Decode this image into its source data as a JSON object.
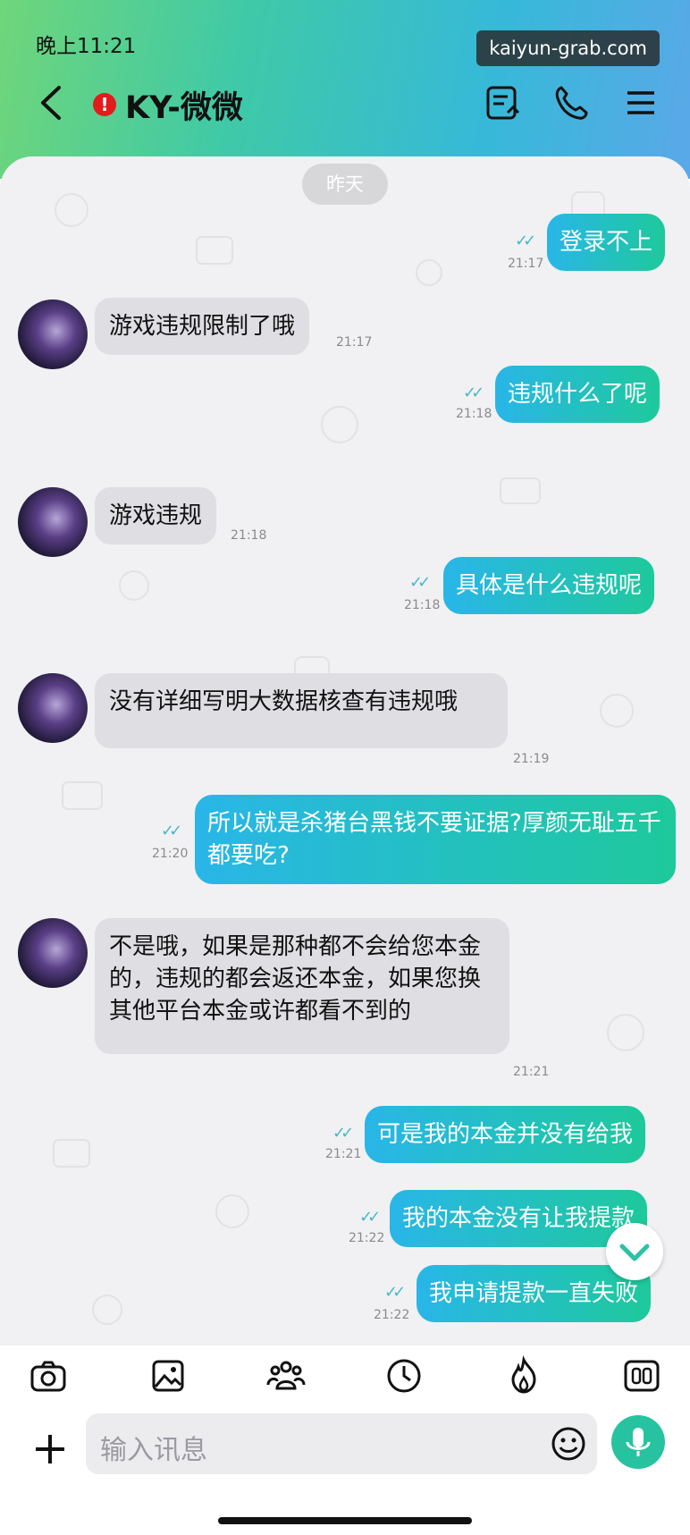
{
  "status": {
    "time": "晚上11:21",
    "watermark": "kaiyun-grab.com"
  },
  "header": {
    "title": "KY-微微",
    "alert": "!"
  },
  "chat": {
    "date_divider": "昨天",
    "messages": [
      {
        "dir": "out",
        "text": "登录不上",
        "time": "21:17"
      },
      {
        "dir": "in",
        "text": "游戏违规限制了哦",
        "time": "21:17"
      },
      {
        "dir": "out",
        "text": "违规什么了呢",
        "time": "21:18"
      },
      {
        "dir": "in",
        "text": "游戏违规",
        "time": "21:18"
      },
      {
        "dir": "out",
        "text": "具体是什么违规呢",
        "time": "21:18"
      },
      {
        "dir": "in",
        "text": "没有详细写明大数据核查有违规哦",
        "time": "21:19"
      },
      {
        "dir": "out",
        "text": "所以就是杀猪台黑钱不要证据?厚颜无耻五千都要吃?",
        "time": "21:20"
      },
      {
        "dir": "in",
        "text": "不是哦，如果是那种都不会给您本金的，违规的都会返还本金，如果您换其他平台本金或许都看不到的",
        "time": "21:21"
      },
      {
        "dir": "out",
        "text": "可是我的本金并没有给我",
        "time": "21:21"
      },
      {
        "dir": "out",
        "text": "我的本金没有让我提款",
        "time": "21:22"
      },
      {
        "dir": "out",
        "text": "我申请提款一直失败",
        "time": "21:22"
      }
    ]
  },
  "composer": {
    "placeholder": "输入讯息"
  },
  "colors": {
    "accent_start": "#29b6e8",
    "accent_end": "#1ec99b",
    "alert": "#e21b1b"
  }
}
